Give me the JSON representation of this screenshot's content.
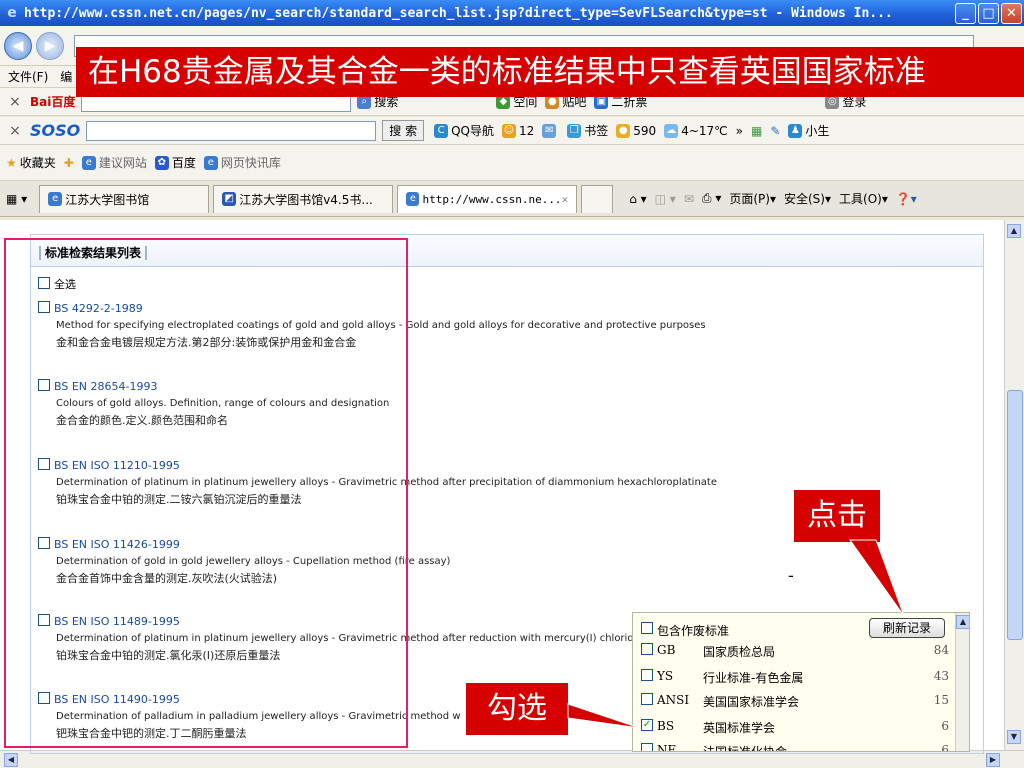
{
  "window": {
    "title": "http://www.cssn.net.cn/pages/nv_search/standard_search_list.jsp?direct_type=SevFLSearch&type=st - Windows In...",
    "min": "_",
    "max": "□",
    "close": "✕"
  },
  "menu": [
    "文件(F)",
    "编"
  ],
  "toolbar1": {
    "logo": "Bai百度",
    "items": [
      "搜索",
      "空间",
      "贴吧",
      "二折票",
      "登录"
    ]
  },
  "toolbar2": {
    "logo": "SOSO",
    "search_button": "搜 索",
    "items": [
      "QQ导航",
      "12",
      "书签",
      "590",
      "4~17℃",
      "»",
      "小生"
    ]
  },
  "favorites": {
    "label": "收藏夹",
    "items": [
      "建议网站",
      "百度",
      "网页快讯库"
    ]
  },
  "tabs": [
    "江苏大学图书馆",
    "江苏大学图书馆v4.5书...",
    "http://www.cssn.ne..."
  ],
  "tabbar_right": [
    "页面(P)",
    "安全(S)",
    "工具(O)"
  ],
  "panel": {
    "title": "标准检索结果列表",
    "select_all": "全选",
    "results": [
      {
        "code": "BS 4292-2-1989",
        "en": "Method for specifying electroplated coatings of gold and gold alloys - Gold and gold alloys for decorative and protective purposes",
        "cn": "金和金合金电镀层规定方法.第2部分:装饰或保护用金和金合金"
      },
      {
        "code": "BS EN 28654-1993",
        "en": "Colours of gold alloys. Definition, range of colours and designation",
        "cn": "金合金的颜色.定义.颜色范围和命名"
      },
      {
        "code": "BS EN ISO 11210-1995",
        "en": "Determination of platinum in platinum jewellery alloys - Gravimetric method after precipitation of diammonium hexachloroplatinate",
        "cn": "铂珠宝合金中铂的测定.二铵六氯铂沉淀后的重量法"
      },
      {
        "code": "BS EN ISO 11426-1999",
        "en": "Determination of gold in gold jewellery alloys - Cupellation method (fire assay)",
        "cn": "金合金首饰中金含量的测定.灰吹法(火试验法)"
      },
      {
        "code": "BS EN ISO 11489-1995",
        "en": "Determination of platinum in platinum jewellery alloys - Gravimetric method after reduction with mercury(I) chloride",
        "cn": "铂珠宝合金中铂的测定.氯化汞(I)还原后重量法"
      },
      {
        "code": "BS EN ISO 11490-1995",
        "en": "Determination of palladium in palladium jewellery alloys - Gravimetric method w",
        "cn": "钯珠宝合金中钯的测定.丁二酮肟重量法"
      }
    ]
  },
  "facet": {
    "include_label": "包含作废标准",
    "refresh": "刷新记录",
    "rows": [
      {
        "code": "GB",
        "name": "国家质检总局",
        "count": "84",
        "checked": false
      },
      {
        "code": "YS",
        "name": "行业标准-有色金属",
        "count": "43",
        "checked": false
      },
      {
        "code": "ANSI",
        "name": "美国国家标准学会",
        "count": "15",
        "checked": false
      },
      {
        "code": "BS",
        "name": "英国标准学会",
        "count": "6",
        "checked": true
      },
      {
        "code": "NF",
        "name": "法国标准化协会",
        "count": "6",
        "checked": false
      }
    ]
  },
  "annotations": {
    "banner": "在H68贵金属及其合金一类的标准结果中只查看英国国家标准",
    "click": "点击",
    "check": "勾选",
    "dash": "-"
  },
  "colors": {
    "annotation_red": "#d60000",
    "highlight_pink": "#e0216a",
    "link_blue": "#1a4a9c"
  }
}
